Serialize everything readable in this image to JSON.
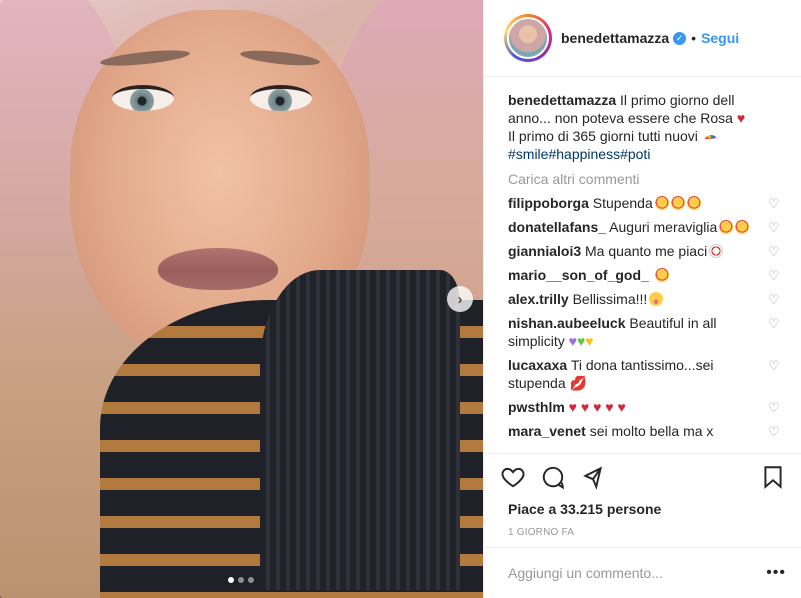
{
  "post": {
    "image": {
      "carousel_total": 3,
      "carousel_active": 1
    },
    "header": {
      "username": "benedettamazza",
      "separator": "•",
      "follow_label": "Segui"
    },
    "caption": {
      "username": "benedettamazza",
      "line1": "Il primo giorno dell anno... non poteva essere che Rosa",
      "line2": "Il primo di 365 giorni tutti nuovi",
      "hashtags": "#smile#happiness#poti"
    },
    "load_more_label": "Carica altri commenti",
    "comments": [
      {
        "user": "filippoborga",
        "text": "Stupenda",
        "emoji": [
          "star",
          "star",
          "star"
        ]
      },
      {
        "user": "donatellafans_",
        "text": "Auguri meraviglia",
        "emoji": [
          "star",
          "star"
        ]
      },
      {
        "user": "giannialoi3",
        "text": "Ma quanto me piaci",
        "emoji": [
          "clown"
        ]
      },
      {
        "user": "mario__son_of_god_",
        "text": "",
        "emoji": [
          "star"
        ]
      },
      {
        "user": "alex.trilly",
        "text": "Bellissima!!!",
        "emoji": [
          "yum"
        ]
      },
      {
        "user": "nishan.aubeeluck",
        "text": "Beautiful in all simplicity",
        "emoji": [
          "purple-heart",
          "green-heart",
          "yellow-heart"
        ]
      },
      {
        "user": "lucaxaxa",
        "text": "Ti dona tantissimo...sei stupenda",
        "emoji": [
          "kiss"
        ]
      },
      {
        "user": "pwsthlm",
        "text": "",
        "emoji": [
          "heart",
          "heart",
          "heart",
          "heart",
          "heart"
        ]
      },
      {
        "user": "mara_venet",
        "text": "sei molto bella ma x",
        "emoji": []
      }
    ],
    "likes_text": "Piace a 33.215 persone",
    "time_text": "1 GIORNO FA",
    "add_comment_placeholder": "Aggiungi un commento...",
    "more_label": "•••",
    "colors": {
      "link": "#3897f0",
      "hashtag": "#003569",
      "muted": "#999999"
    },
    "icons": {
      "like": "heart-icon",
      "comment": "comment-bubble-icon",
      "share": "share-icon",
      "save": "bookmark-icon",
      "next": "chevron-right-icon",
      "verified": "verified-badge-icon"
    }
  }
}
